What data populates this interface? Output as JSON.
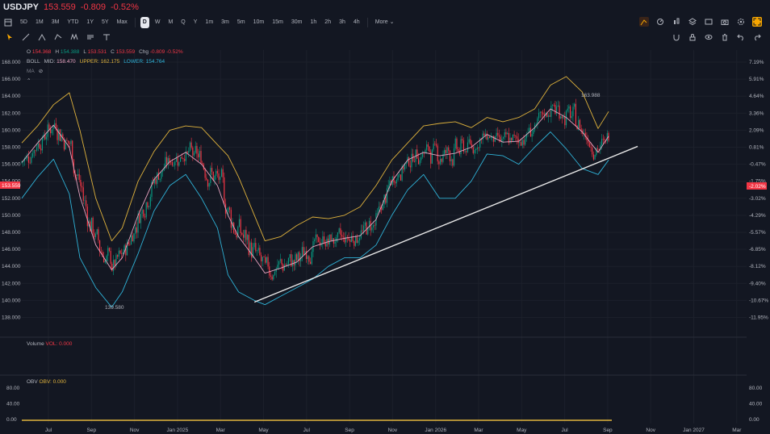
{
  "header": {
    "symbol": "USDJPY",
    "price": "153.559",
    "change": "-0.809",
    "change_pct": "-0.52%"
  },
  "timeframes": [
    "5D",
    "1M",
    "3M",
    "YTD",
    "1Y",
    "5Y",
    "Max",
    "D",
    "W",
    "M",
    "Q",
    "Y",
    "1m",
    "3m",
    "5m",
    "10m",
    "15m",
    "30m",
    "1h",
    "2h",
    "3h",
    "4h",
    "More"
  ],
  "active_timeframe": "D",
  "legend": {
    "o_label": "O",
    "o": "154.368",
    "h_label": "H",
    "h": "154.388",
    "l_label": "L",
    "l": "153.531",
    "c_label": "C",
    "c": "153.559",
    "chg_label": "Chg",
    "chg": "-0.809",
    "chg_pct": "-0.52%",
    "boll": "BOLL",
    "mid_label": "MID:",
    "mid": "158.470",
    "upper_label": "UPPER:",
    "upper": "162.175",
    "lower_label": "LOWER:",
    "lower": "154.764",
    "ma": "MA"
  },
  "volume_pane": {
    "label": "Volume",
    "value_label": "VOL:",
    "value": "0.000"
  },
  "obv_pane": {
    "label": "OBV",
    "value_label": "OBV:",
    "value": "0.000",
    "ticks": [
      "80.00",
      "40.00",
      "0.00"
    ]
  },
  "price_axis": [
    "168.000",
    "166.000",
    "164.000",
    "162.000",
    "160.000",
    "158.000",
    "156.000",
    "154.000",
    "152.000",
    "150.000",
    "148.000",
    "146.000",
    "144.000",
    "142.000",
    "140.000",
    "138.000"
  ],
  "percent_axis": [
    "7.19%",
    "5.91%",
    "4.64%",
    "3.36%",
    "2.09%",
    "0.81%",
    "-0.47%",
    "-1.75%",
    "-3.02%",
    "-4.29%",
    "-5.57%",
    "-6.85%",
    "-8.12%",
    "-9.40%",
    "-10.67%",
    "-11.95%"
  ],
  "current_price_tag": "153.559",
  "current_pct_tag": "-2.02%",
  "time_axis": [
    "Jul",
    "Sep",
    "Nov",
    "Jan 2025",
    "Mar",
    "May",
    "Jul",
    "Sep",
    "Nov",
    "Jan 2026",
    "Mar",
    "May",
    "Jul",
    "Sep",
    "Nov",
    "Jan 2027",
    "Mar"
  ],
  "annotations": {
    "high": "163.988",
    "low": "139.580"
  },
  "colors": {
    "up": "#089981",
    "down": "#f23645",
    "upper": "#e0b33c",
    "mid": "#e8a3c0",
    "lower": "#2fb3d8",
    "accent": "#f7a600",
    "bg": "#131722"
  },
  "chart_data": {
    "type": "line",
    "title": "",
    "ylim": [
      137,
      169
    ],
    "series": [
      {
        "name": "MID",
        "anchors": [
          [
            0,
            156.2
          ],
          [
            0.03,
            158.5
          ],
          [
            0.06,
            160.6
          ],
          [
            0.09,
            158.0
          ],
          [
            0.11,
            152.2
          ],
          [
            0.14,
            146.5
          ],
          [
            0.17,
            143.6
          ],
          [
            0.19,
            145.0
          ],
          [
            0.22,
            150.0
          ],
          [
            0.25,
            154.2
          ],
          [
            0.28,
            156.3
          ],
          [
            0.31,
            157.4
          ],
          [
            0.34,
            156.0
          ],
          [
            0.37,
            153.5
          ],
          [
            0.39,
            150.0
          ],
          [
            0.41,
            147.5
          ],
          [
            0.44,
            145.0
          ],
          [
            0.46,
            143.2
          ],
          [
            0.49,
            143.8
          ],
          [
            0.52,
            144.5
          ],
          [
            0.55,
            146.3
          ],
          [
            0.58,
            146.9
          ],
          [
            0.61,
            147.3
          ],
          [
            0.64,
            147.6
          ],
          [
            0.67,
            149.5
          ],
          [
            0.7,
            154.0
          ],
          [
            0.73,
            156.5
          ],
          [
            0.76,
            157.4
          ],
          [
            0.79,
            157.0
          ],
          [
            0.82,
            157.3
          ],
          [
            0.85,
            158.0
          ],
          [
            0.88,
            159.5
          ],
          [
            0.91,
            158.6
          ],
          [
            0.94,
            158.7
          ],
          [
            0.97,
            160.3
          ],
          [
            1.0,
            162.5
          ],
          [
            1.03,
            161.5
          ],
          [
            1.06,
            159.8
          ],
          [
            1.09,
            157.4
          ],
          [
            1.11,
            159.3
          ]
        ]
      },
      {
        "name": "UPPER",
        "anchors": [
          [
            0,
            158.5
          ],
          [
            0.03,
            160.5
          ],
          [
            0.06,
            163.0
          ],
          [
            0.09,
            164.4
          ],
          [
            0.11,
            160.0
          ],
          [
            0.14,
            152.0
          ],
          [
            0.17,
            147.0
          ],
          [
            0.19,
            148.5
          ],
          [
            0.22,
            154.0
          ],
          [
            0.25,
            157.5
          ],
          [
            0.28,
            160.0
          ],
          [
            0.31,
            160.5
          ],
          [
            0.34,
            160.3
          ],
          [
            0.37,
            158.3
          ],
          [
            0.39,
            157.0
          ],
          [
            0.41,
            154.5
          ],
          [
            0.44,
            150.0
          ],
          [
            0.46,
            147.0
          ],
          [
            0.49,
            147.5
          ],
          [
            0.52,
            148.8
          ],
          [
            0.55,
            149.8
          ],
          [
            0.58,
            149.6
          ],
          [
            0.61,
            150.0
          ],
          [
            0.64,
            151.0
          ],
          [
            0.67,
            153.5
          ],
          [
            0.7,
            156.5
          ],
          [
            0.73,
            158.5
          ],
          [
            0.76,
            160.5
          ],
          [
            0.79,
            160.8
          ],
          [
            0.82,
            161.0
          ],
          [
            0.85,
            160.3
          ],
          [
            0.88,
            161.5
          ],
          [
            0.91,
            161.0
          ],
          [
            0.94,
            161.5
          ],
          [
            0.97,
            162.5
          ],
          [
            1.0,
            165.3
          ],
          [
            1.03,
            166.3
          ],
          [
            1.06,
            164.5
          ],
          [
            1.09,
            160.2
          ],
          [
            1.11,
            162.2
          ]
        ]
      },
      {
        "name": "LOWER",
        "anchors": [
          [
            0,
            152.0
          ],
          [
            0.03,
            154.5
          ],
          [
            0.06,
            156.6
          ],
          [
            0.09,
            152.5
          ],
          [
            0.11,
            145.0
          ],
          [
            0.14,
            141.5
          ],
          [
            0.17,
            139.2
          ],
          [
            0.19,
            141.0
          ],
          [
            0.22,
            145.5
          ],
          [
            0.25,
            150.5
          ],
          [
            0.28,
            153.5
          ],
          [
            0.31,
            154.8
          ],
          [
            0.34,
            152.0
          ],
          [
            0.37,
            148.5
          ],
          [
            0.39,
            143.0
          ],
          [
            0.41,
            141.0
          ],
          [
            0.44,
            140.0
          ],
          [
            0.46,
            139.5
          ],
          [
            0.49,
            140.5
          ],
          [
            0.52,
            141.5
          ],
          [
            0.55,
            142.5
          ],
          [
            0.58,
            144.0
          ],
          [
            0.61,
            145.0
          ],
          [
            0.64,
            145.0
          ],
          [
            0.67,
            146.5
          ],
          [
            0.7,
            150.0
          ],
          [
            0.73,
            153.0
          ],
          [
            0.76,
            154.8
          ],
          [
            0.79,
            152.0
          ],
          [
            0.82,
            152.0
          ],
          [
            0.85,
            154.0
          ],
          [
            0.88,
            157.2
          ],
          [
            0.91,
            157.0
          ],
          [
            0.94,
            156.0
          ],
          [
            0.97,
            158.0
          ],
          [
            1.0,
            159.8
          ],
          [
            1.03,
            157.8
          ],
          [
            1.06,
            155.5
          ],
          [
            1.09,
            154.8
          ],
          [
            1.11,
            156.5
          ]
        ]
      }
    ],
    "trendline": [
      [
        0.44,
        139.8
      ],
      [
        1.165,
        158.1
      ]
    ]
  }
}
